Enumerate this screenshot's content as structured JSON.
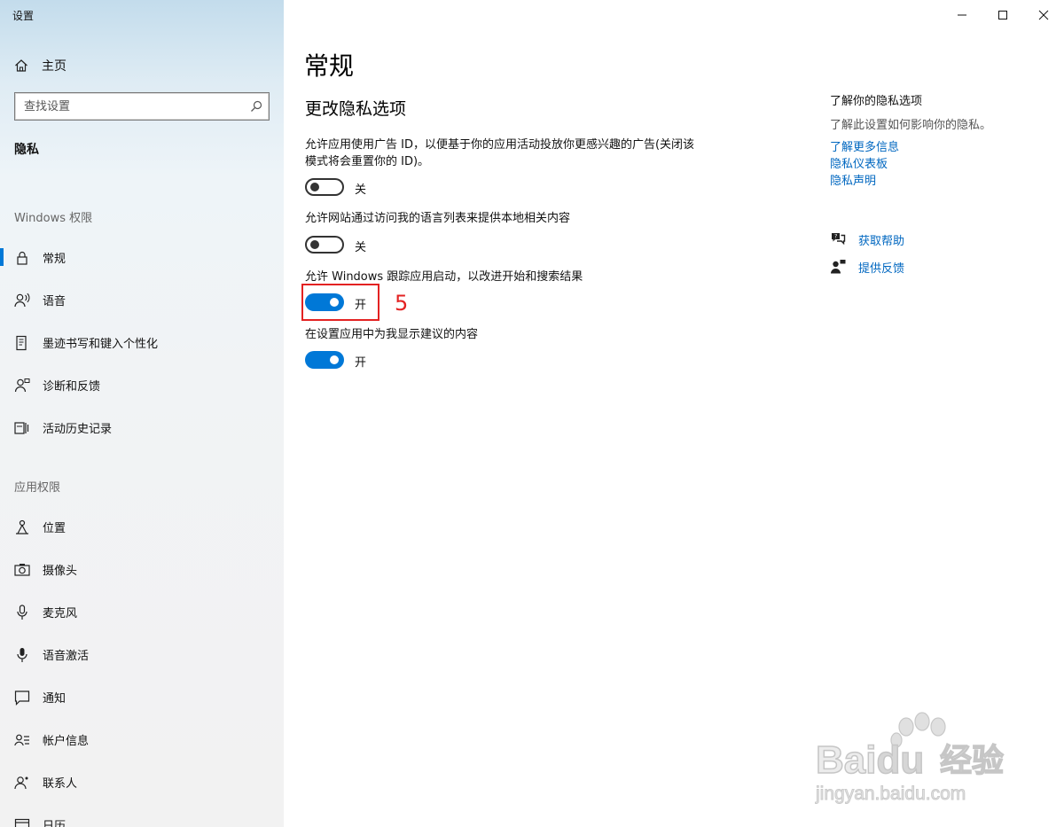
{
  "window": {
    "title": "设置",
    "minimize": "minimize-icon",
    "maximize": "maximize-icon",
    "close": "close-icon"
  },
  "sidebar": {
    "home": "主页",
    "search_placeholder": "查找设置",
    "section": "隐私",
    "group_windows": "Windows 权限",
    "group_apps": "应用权限",
    "windows_items": [
      {
        "label": "常规",
        "icon": "lock-icon",
        "active": true
      },
      {
        "label": "语音",
        "icon": "speech-icon"
      },
      {
        "label": "墨迹书写和键入个性化",
        "icon": "inking-icon"
      },
      {
        "label": "诊断和反馈",
        "icon": "feedback-person-icon"
      },
      {
        "label": "活动历史记录",
        "icon": "timeline-icon"
      }
    ],
    "app_items": [
      {
        "label": "位置",
        "icon": "location-icon"
      },
      {
        "label": "摄像头",
        "icon": "camera-icon"
      },
      {
        "label": "麦克风",
        "icon": "microphone-icon"
      },
      {
        "label": "语音激活",
        "icon": "voice-activation-icon"
      },
      {
        "label": "通知",
        "icon": "notification-icon"
      },
      {
        "label": "帐户信息",
        "icon": "account-info-icon"
      },
      {
        "label": "联系人",
        "icon": "contacts-icon"
      },
      {
        "label": "日历",
        "icon": "calendar-icon"
      }
    ]
  },
  "main": {
    "title": "常规",
    "subheading": "更改隐私选项",
    "settings": [
      {
        "desc": "允许应用使用广告 ID，以便基于你的应用活动投放你更感兴趣的广告(关闭该模式将会重置你的 ID)。",
        "state": "关",
        "on": false
      },
      {
        "desc": "允许网站通过访问我的语言列表来提供本地相关内容",
        "state": "关",
        "on": false
      },
      {
        "desc": "允许 Windows 跟踪应用启动，以改进开始和搜索结果",
        "state": "开",
        "on": true
      },
      {
        "desc": "在设置应用中为我显示建议的内容",
        "state": "开",
        "on": true
      }
    ],
    "annotation": "5"
  },
  "right": {
    "title": "了解你的隐私选项",
    "desc": "了解此设置如何影响你的隐私。",
    "links": [
      "了解更多信息",
      "隐私仪表板",
      "隐私声明"
    ],
    "help": [
      {
        "label": "获取帮助",
        "icon": "help-chat-icon"
      },
      {
        "label": "提供反馈",
        "icon": "feedback-icon"
      }
    ]
  },
  "watermark": {
    "brand": "Baidu",
    "brand_cn": "经验",
    "url": "jingyan.baidu.com"
  }
}
